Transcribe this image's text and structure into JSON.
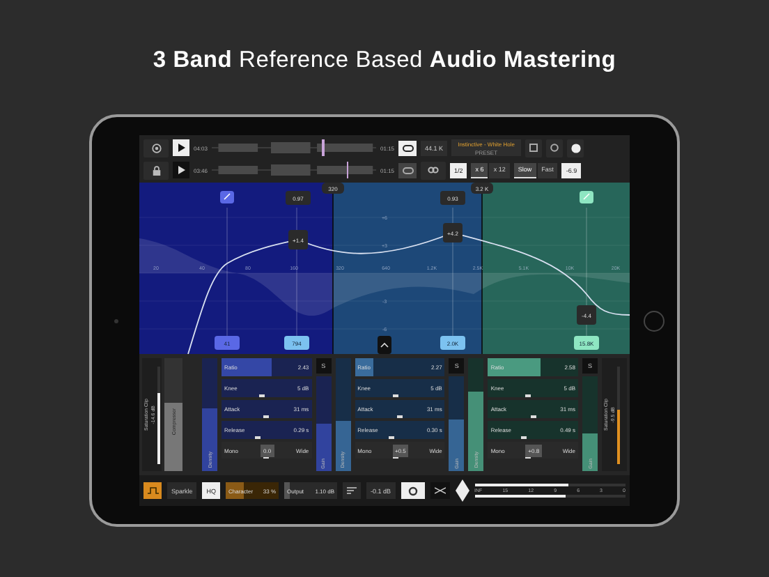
{
  "headline": "**3 Band** Reference Based **Audio Mastering**",
  "tracks": [
    {
      "time": "04:03",
      "length": "01:15",
      "level": 0.67,
      "active": true,
      "loop_active": true
    },
    {
      "time": "03:46",
      "length": "01:15",
      "level": 0.82,
      "active": false,
      "loop_active": false
    }
  ],
  "sample_rate": "44.1 K",
  "preset": {
    "name": "Instinctive - White Hole",
    "label": "PRESET"
  },
  "screens": "1/2",
  "oversampling": [
    {
      "label": "x 6",
      "selected": true
    },
    {
      "label": "x 12",
      "selected": false
    }
  ],
  "speed": [
    {
      "label": "Slow",
      "selected": true
    },
    {
      "label": "Fast",
      "selected": false
    }
  ],
  "target": "-6.9",
  "eq": {
    "bands": [
      {
        "color": "#131b7e"
      },
      {
        "color": "#1d4878"
      },
      {
        "color": "#27665a"
      }
    ],
    "crossovers": [
      "320",
      "3.2 K"
    ],
    "y_labels": [
      "+6",
      "+3",
      "-3",
      "-6"
    ],
    "x_labels": [
      "20",
      "40",
      "80",
      "160",
      "320",
      "640",
      "1.2K",
      "2.5K",
      "5.1K",
      "10K",
      "20K"
    ],
    "q_handles": [
      "0.97",
      "0.93"
    ],
    "gain_handles": [
      "+1.4",
      "+4.2",
      "-4.4"
    ],
    "freq_handles": [
      {
        "value": "41",
        "color": "#5a68e6"
      },
      {
        "value": "794",
        "color": "#7cc2f0"
      },
      {
        "value": "2.0K",
        "color": "#7cc2f0"
      },
      {
        "value": "15.8K",
        "color": "#8ee6c2"
      }
    ]
  },
  "left": {
    "clip_label": "Saturation Clip",
    "clip_value": "-14.6 dB",
    "level": 0.72,
    "compressor": {
      "label": "Compressor",
      "level": 0.6
    }
  },
  "bands": [
    {
      "color": "#1a2352",
      "density": {
        "label": "Density",
        "level": 0.55
      },
      "solo": "S",
      "gain": {
        "label": "Gain",
        "level": 0.5
      },
      "stereo": {
        "mono_label": "Mono",
        "value": "0.0",
        "wide_label": "Wide",
        "level": 0.5
      },
      "params": [
        {
          "name": "Ratio",
          "value": "2.43",
          "level": 0.55,
          "kind": "bar"
        },
        {
          "name": "Knee",
          "value": "5 dB",
          "level": 0.45,
          "kind": "marker"
        },
        {
          "name": "Attack",
          "value": "31 ms",
          "level": 0.5,
          "kind": "marker"
        },
        {
          "name": "Release",
          "value": "0.29 s",
          "level": 0.4,
          "kind": "marker"
        }
      ]
    },
    {
      "color": "#172e48",
      "density": {
        "label": "Density",
        "level": 0.45
      },
      "solo": "S",
      "gain": {
        "label": "Gain",
        "level": 0.55
      },
      "stereo": {
        "mono_label": "Mono",
        "value": "+0.5",
        "wide_label": "Wide",
        "level": 0.45
      },
      "params": [
        {
          "name": "Ratio",
          "value": "2.27",
          "level": 0.2,
          "kind": "bar"
        },
        {
          "name": "Knee",
          "value": "5 dB",
          "level": 0.45,
          "kind": "marker"
        },
        {
          "name": "Attack",
          "value": "31 ms",
          "level": 0.5,
          "kind": "marker"
        },
        {
          "name": "Release",
          "value": "0.30 s",
          "level": 0.4,
          "kind": "marker"
        }
      ]
    },
    {
      "color": "#17332c",
      "density": {
        "label": "Density",
        "level": 0.7
      },
      "solo": "S",
      "gain": {
        "label": "Gain",
        "level": 0.4
      },
      "stereo": {
        "mono_label": "Mono",
        "value": "+0.8",
        "wide_label": "Wide",
        "level": 0.45
      },
      "params": [
        {
          "name": "Ratio",
          "value": "2.58",
          "level": 0.58,
          "kind": "bar"
        },
        {
          "name": "Knee",
          "value": "5 dB",
          "level": 0.45,
          "kind": "marker"
        },
        {
          "name": "Attack",
          "value": "31 ms",
          "level": 0.5,
          "kind": "marker"
        },
        {
          "name": "Release",
          "value": "0.49 s",
          "level": 0.4,
          "kind": "marker"
        }
      ]
    }
  ],
  "right": {
    "clip_label": "Saturation Clip",
    "clip_value": "-9.5 dB",
    "level": 0.55
  },
  "bottom": {
    "sparkle": "Sparkle",
    "hq": "HQ",
    "character": {
      "label": "Character",
      "value": "33 %",
      "level": 0.33
    },
    "output": {
      "label": "Output",
      "value": "1.10 dB",
      "level": 0.1
    },
    "ceiling": "-0.1 dB",
    "meter": {
      "top": {
        "level": 0.62
      },
      "bottom": {
        "level": 0.6
      },
      "scale": [
        "INF",
        "15",
        "12",
        "9",
        "6",
        "3",
        "0"
      ]
    }
  }
}
